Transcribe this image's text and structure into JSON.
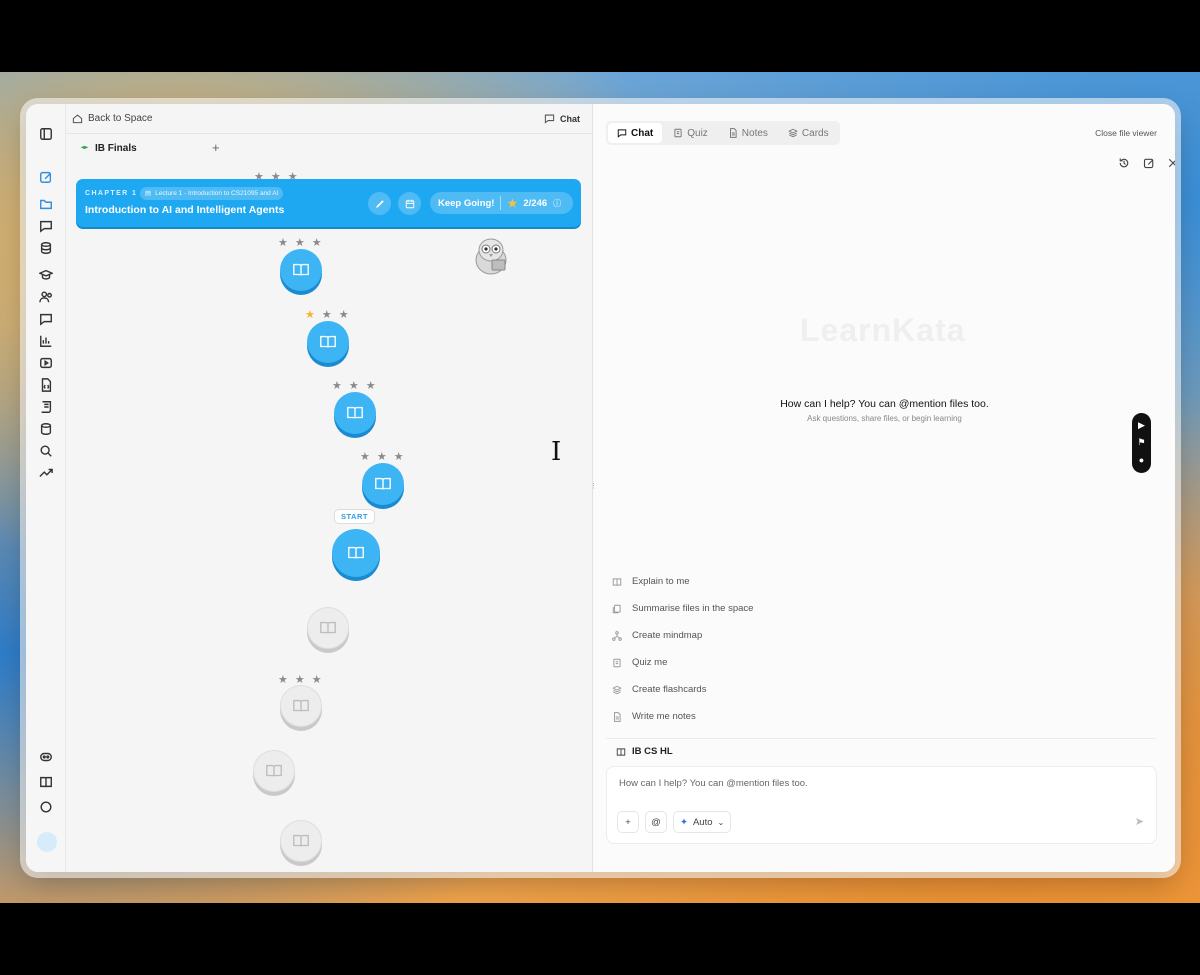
{
  "left": {
    "back_label": "Back to Space",
    "chat_label": "Chat",
    "space_tab": "IB Finals",
    "add_label": "+"
  },
  "chapter": {
    "label": "CHAPTER 1",
    "lecture": "Lecture 1 - Introduction to CS21095 and AI",
    "title": "Introduction to AI and Intelligent Agents",
    "keep_going": "Keep Going!",
    "progress": "2/246"
  },
  "path": {
    "start_label": "START",
    "nodes_completed": 5,
    "nodes_locked": 4
  },
  "right": {
    "tabs": [
      "Chat",
      "Quiz",
      "Notes",
      "Cards"
    ],
    "close_viewer": "Close file viewer",
    "watermark": "LearnKata",
    "help_title": "How can I help? You can @mention files too.",
    "help_sub": "Ask questions, share files, or begin learning",
    "suggestions": [
      "Explain to me",
      "Summarise files in the space",
      "Create mindmap",
      "Quiz me",
      "Create flashcards",
      "Write me notes"
    ],
    "context_label": "IB CS HL",
    "input_placeholder": "How can I help? You can @mention files too.",
    "mode_label": "Auto"
  },
  "colors": {
    "accent": "#1ea8f2",
    "star": "#f2b630"
  }
}
